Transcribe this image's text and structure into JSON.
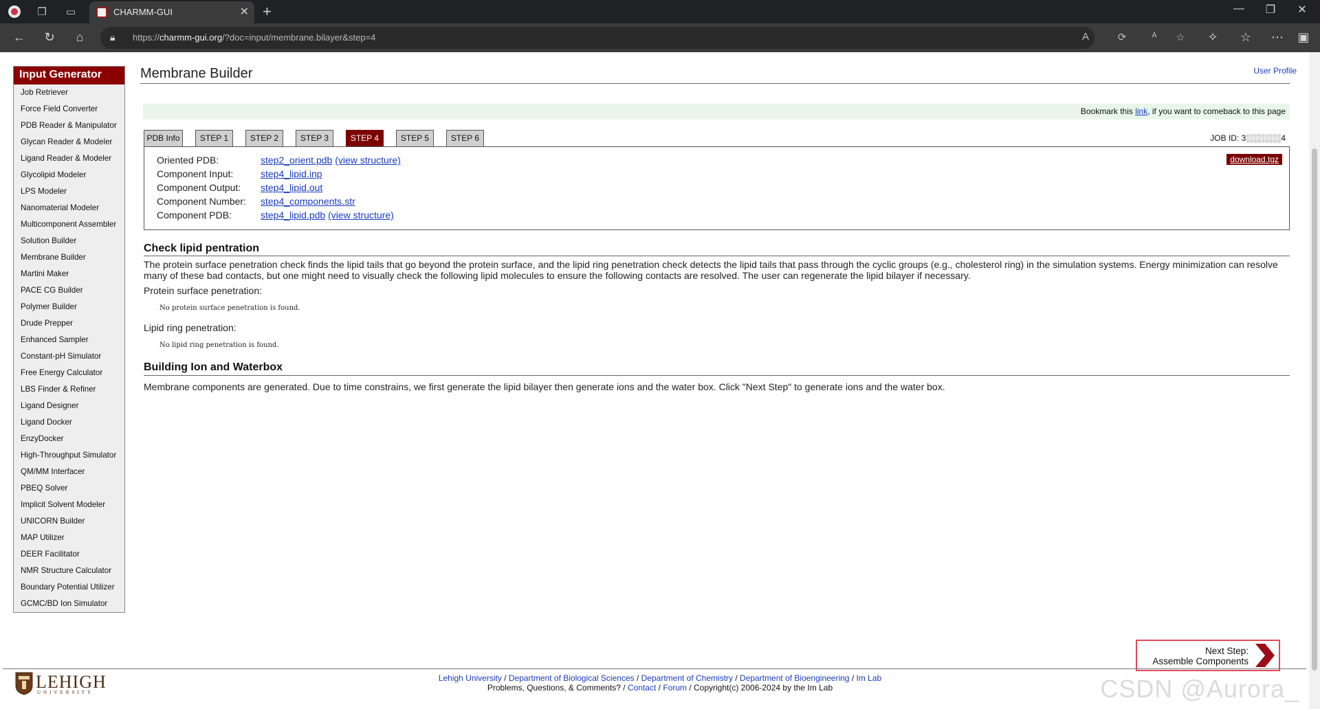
{
  "browser": {
    "tab_title": "CHARMM-GUI",
    "url_prefix": "https://",
    "url_host": "charmm-gui.org",
    "url_path": "/?doc=input/membrane.bilayer&step=4"
  },
  "sidebar": {
    "title": "Input Generator",
    "items": [
      "Job Retriever",
      "Force Field Converter",
      "PDB Reader & Manipulator",
      "Glycan Reader & Modeler",
      "Ligand Reader & Modeler",
      "Glycolipid Modeler",
      "LPS Modeler",
      "Nanomaterial Modeler",
      "Multicomponent Assembler",
      "Solution Builder",
      "Membrane Builder",
      "Martini Maker",
      "PACE CG Builder",
      "Polymer Builder",
      "Drude Prepper",
      "Enhanced Sampler",
      "Constant-pH Simulator",
      "Free Energy Calculator",
      "LBS Finder & Refiner",
      "Ligand Designer",
      "Ligand Docker",
      "EnzyDocker",
      "High-Throughput Simulator",
      "QM/MM Interfacer",
      "PBEQ Solver",
      "Implicit Solvent Modeler",
      "UNICORN Builder",
      "MAP Utilizer",
      "DEER Facilitator",
      "NMR Structure Calculator",
      "Boundary Potential Utilizer",
      "GCMC/BD Ion Simulator"
    ]
  },
  "main": {
    "title": "Membrane Builder",
    "user_profile": "User Profile",
    "bookmark_pre": "Bookmark this ",
    "bookmark_link": "link",
    "bookmark_post": ", if you want to comeback to this page",
    "tabs": [
      "PDB Info",
      "STEP 1",
      "STEP 2",
      "STEP 3",
      "STEP 4",
      "STEP 5",
      "STEP 6"
    ],
    "active_tab": "STEP 4",
    "job_id_label": "JOB ID: ",
    "job_id_value": "3░░░░░░4",
    "download": "download.tgz",
    "files": [
      {
        "label": "Oriented PDB:",
        "file": "step2_orient.pdb",
        "extra": "(view structure)"
      },
      {
        "label": "Component Input:",
        "file": "step4_lipid.inp",
        "extra": ""
      },
      {
        "label": "Component Output:",
        "file": "step4_lipid.out",
        "extra": ""
      },
      {
        "label": "Component Number:",
        "file": "step4_components.str",
        "extra": ""
      },
      {
        "label": "Component PDB:",
        "file": "step4_lipid.pdb",
        "extra": "(view structure)"
      }
    ],
    "check_heading": "Check lipid pentration",
    "check_text": "The protein surface penetration check finds the lipid tails that go beyond the protein surface, and the lipid ring penetration check detects the lipid tails that pass through the cyclic groups (e.g., cholesterol ring) in the simulation systems. Energy minimization can resolve many of these bad contacts, but one might need to visually check the following lipid molecules to ensure the following contacts are resolved. The user can regenerate the lipid bilayer if necessary.",
    "protein_label": "Protein surface penetration:",
    "protein_result": "No protein surface penetration is found.",
    "ring_label": "Lipid ring penetration:",
    "ring_result": "No lipid ring penetration is found.",
    "ion_heading": "Building Ion and Waterbox",
    "ion_text": "Membrane components are generated. Due to time constrains, we first generate the lipid bilayer then generate ions and the water box. Click \"Next Step\" to generate ions and the water box.",
    "next_step_line1": "Next Step:",
    "next_step_line2": "Assemble Components"
  },
  "footer": {
    "logo_name": "LEHIGH",
    "logo_sub": "UNIVERSITY",
    "links": [
      "Lehigh University",
      "Department of Biological Sciences",
      "Department of Chemistry",
      "Department of Bioengineering",
      "Im Lab"
    ],
    "line2_pre": "Problems, Questions, & Comments? / ",
    "contact": "Contact",
    "forum": "Forum",
    "copyright": " / Copyright(c) 2006-2024 by the Im Lab",
    "watermark": "CSDN @Aurora_"
  },
  "colors": {
    "brand": "#8b0000",
    "link": "#1a3cbd",
    "bookmark_bg": "#eaf5ea"
  }
}
